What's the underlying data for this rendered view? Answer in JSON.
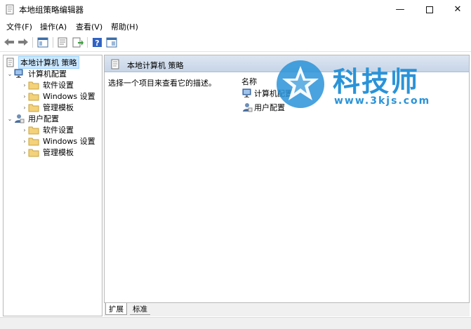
{
  "window": {
    "title": "本地组策略编辑器",
    "minimize_glyph": "—",
    "close_glyph": "✕"
  },
  "menu": {
    "items": [
      "文件(F)",
      "操作(A)",
      "查看(V)",
      "帮助(H)"
    ]
  },
  "toolbar": {
    "buttons": [
      "back-arrow-icon",
      "forward-arrow-icon",
      "show-tree-icon",
      "properties-icon",
      "export-list-icon",
      "help-icon",
      "view-icon"
    ]
  },
  "tree": {
    "root": "本地计算机 策略",
    "computer": "计算机配置",
    "computer_children": [
      "软件设置",
      "Windows 设置",
      "管理模板"
    ],
    "user": "用户配置",
    "user_children": [
      "软件设置",
      "Windows 设置",
      "管理模板"
    ],
    "expanded_glyph": "⌄",
    "collapsed_glyph": "›"
  },
  "detail": {
    "header_title": "本地计算机 策略",
    "description": "选择一个项目来查看它的描述。",
    "column_name": "名称",
    "items": [
      "计算机配置",
      "用户配置"
    ]
  },
  "tabs": [
    "扩展",
    "标准"
  ],
  "watermark": {
    "brand": "科技师",
    "url": "www.3kjs.com"
  },
  "colors": {
    "accent": "#2a93d8",
    "selection": "#cce8ff",
    "header_gradient_top": "#dde6f1",
    "header_gradient_bottom": "#c7d5e8"
  }
}
